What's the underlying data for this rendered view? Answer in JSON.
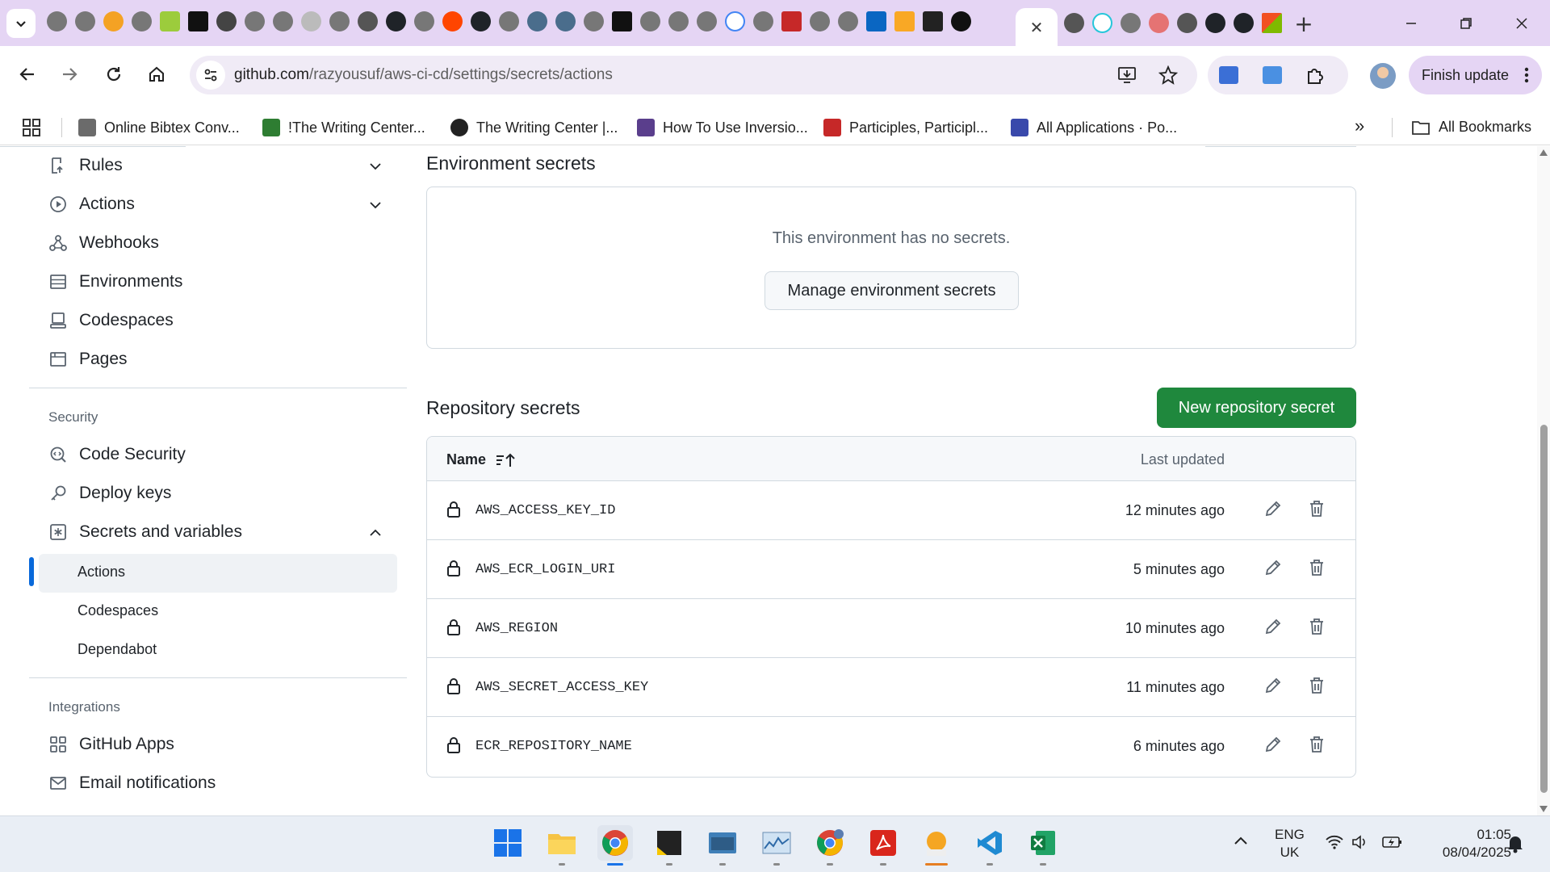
{
  "browser": {
    "tab_close_glyph": "✕",
    "new_tab_glyph": "+",
    "url_host": "github.com",
    "url_path": "/razyousuf/aws-ci-cd/settings/secrets/actions",
    "finish_update_label": "Finish update",
    "bookmarks": [
      {
        "label": "Online Bibtex Conv...",
        "icon": "document-icon",
        "color": "#6b6b6b"
      },
      {
        "label": "!The Writing Center...",
        "icon": "m-logo-icon",
        "color": "#2e7d32"
      },
      {
        "label": "The Writing Center |...",
        "icon": "globe-icon",
        "color": "#222222"
      },
      {
        "label": "How To Use Inversio...",
        "icon": "jpa-logo-icon",
        "color": "#5a3e8c"
      },
      {
        "label": "Participles, Participl...",
        "icon": "uk-flag-icon",
        "color": "#c62828"
      },
      {
        "label": "All Applications · Po...",
        "icon": "crest-icon",
        "color": "#3949ab"
      }
    ],
    "bookmarks_overflow": "»",
    "all_bookmarks_label": "All Bookmarks"
  },
  "sidebar": {
    "items_top": [
      {
        "label": "Rules",
        "icon": "rules-icon",
        "expand": "down"
      },
      {
        "label": "Actions",
        "icon": "play-icon",
        "expand": "down"
      },
      {
        "label": "Webhooks",
        "icon": "webhook-icon"
      },
      {
        "label": "Environments",
        "icon": "server-icon"
      },
      {
        "label": "Codespaces",
        "icon": "codespaces-icon"
      },
      {
        "label": "Pages",
        "icon": "browser-icon"
      }
    ],
    "security_heading": "Security",
    "security_items": [
      {
        "label": "Code Security",
        "icon": "codescan-icon"
      },
      {
        "label": "Deploy keys",
        "icon": "key-icon"
      },
      {
        "label": "Secrets and variables",
        "icon": "asterisk-icon",
        "expand": "up"
      }
    ],
    "sub_items": [
      "Actions",
      "Codespaces",
      "Dependabot"
    ],
    "active_sub_item": "Actions",
    "integrations_heading": "Integrations",
    "integration_items": [
      {
        "label": "GitHub Apps",
        "icon": "apps-icon"
      },
      {
        "label": "Email notifications",
        "icon": "mail-icon"
      }
    ]
  },
  "environment_secrets": {
    "title": "Environment secrets",
    "empty_message": "This environment has no secrets.",
    "manage_button": "Manage environment secrets"
  },
  "repository_secrets": {
    "title": "Repository secrets",
    "new_button": "New repository secret",
    "col_name": "Name",
    "col_updated": "Last updated",
    "rows": [
      {
        "name": "AWS_ACCESS_KEY_ID",
        "updated": "12 minutes ago"
      },
      {
        "name": "AWS_ECR_LOGIN_URI",
        "updated": "5 minutes ago"
      },
      {
        "name": "AWS_REGION",
        "updated": "10 minutes ago"
      },
      {
        "name": "AWS_SECRET_ACCESS_KEY",
        "updated": "11 minutes ago"
      },
      {
        "name": "ECR_REPOSITORY_NAME",
        "updated": "6 minutes ago"
      }
    ]
  },
  "taskbar": {
    "lang_line1": "ENG",
    "lang_line2": "UK",
    "time": "01:05",
    "date": "08/04/2025",
    "apps": [
      "windows-start-icon",
      "file-explorer-icon",
      "chrome-icon",
      "sticky-notes-icon",
      "keyboard-app-icon",
      "resource-monitor-icon",
      "chrome-profile-icon",
      "acrobat-icon",
      "zoom-icon",
      "vscode-icon",
      "excel-icon"
    ]
  },
  "colors": {
    "accent_green": "#1f883d",
    "active_indicator": "#0969da",
    "chrome_purple": "#e5d5f4"
  }
}
